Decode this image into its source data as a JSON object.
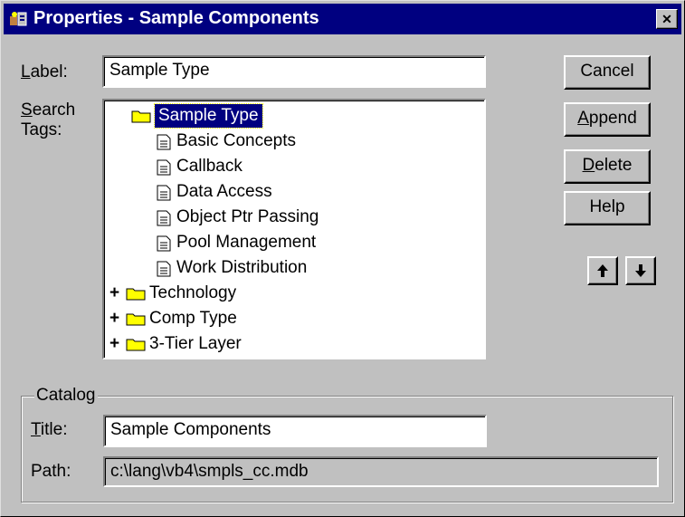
{
  "window": {
    "title": "Properties - Sample Components",
    "close_glyph": "✕"
  },
  "form": {
    "label_caption_u": "L",
    "label_caption_rest": "abel:",
    "label_value": "Sample Type",
    "search_caption_u": "S",
    "search_caption_rest": "earch",
    "search_caption_line2": "Tags:"
  },
  "tree": {
    "root": {
      "label": "Sample Type",
      "expander": "−",
      "selected": true
    },
    "children": [
      "Basic Concepts",
      "Callback",
      "Data Access",
      "Object Ptr Passing",
      "Pool Management",
      "Work Distribution"
    ],
    "siblings": [
      {
        "label": "Technology",
        "expander": "+"
      },
      {
        "label": "Comp Type",
        "expander": "+"
      },
      {
        "label": "3-Tier Layer",
        "expander": "+"
      }
    ]
  },
  "buttons": {
    "cancel": "Cancel",
    "append_u": "A",
    "append_rest": "ppend",
    "delete_u": "D",
    "delete_rest": "elete",
    "help": "Help",
    "up_glyph": "🡅",
    "down_glyph": "🡇"
  },
  "catalog": {
    "group_title": "Catalog",
    "title_caption_u": "T",
    "title_caption_rest": "itle:",
    "title_value": "Sample Components",
    "path_caption": "Path:",
    "path_value": "c:\\lang\\vb4\\smpls_cc.mdb"
  },
  "colors": {
    "face": "#c0c0c0",
    "titlebar": "#000080",
    "selection": "#000080",
    "folder": "#ffff00"
  },
  "icons": {
    "app": "app-icon",
    "folder": "folder-icon",
    "document": "document-icon",
    "close": "close-icon",
    "arrow_up": "arrow-up-icon",
    "arrow_down": "arrow-down-icon"
  }
}
